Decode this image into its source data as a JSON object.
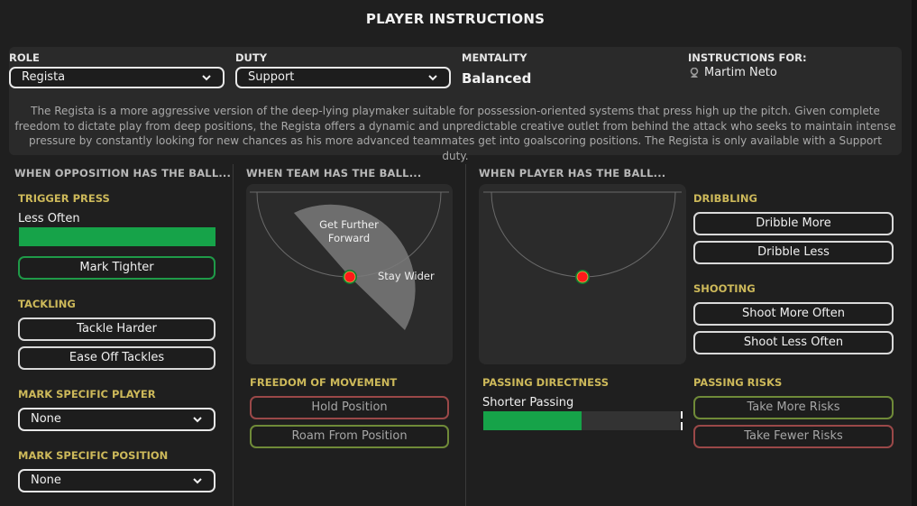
{
  "window": {
    "title": "PLAYER INSTRUCTIONS"
  },
  "header": {
    "role": {
      "label": "ROLE",
      "value": "Regista"
    },
    "duty": {
      "label": "DUTY",
      "value": "Support"
    },
    "mentality": {
      "label": "MENTALITY",
      "value": "Balanced"
    },
    "instructions_for": {
      "label": "INSTRUCTIONS FOR:",
      "player": "Martim Neto",
      "icon": "person-icon"
    },
    "description": "The Regista is a more aggressive version of the deep-lying playmaker suitable for possession-oriented systems that press high up the pitch. Given complete freedom to dictate play from deep positions, the Regista offers a dynamic and unpredictable creative outlet from behind the attack who seeks to maintain intense pressure by constantly looking for new chances as his more advanced teammates get into goalscoring positions. The Regista is only available with a Support duty."
  },
  "opposition": {
    "header": "WHEN OPPOSITION HAS THE BALL...",
    "trigger_press": {
      "label": "TRIGGER PRESS",
      "value": "Less Often",
      "fill_percent": 100
    },
    "mark_tighter": "Mark Tighter",
    "tackling": {
      "label": "TACKLING",
      "buttons": [
        "Tackle Harder",
        "Ease Off Tackles"
      ]
    },
    "mark_player": {
      "label": "MARK SPECIFIC PLAYER",
      "value": "None"
    },
    "mark_position": {
      "label": "MARK SPECIFIC POSITION",
      "value": "None"
    }
  },
  "team": {
    "header": "WHEN TEAM HAS THE BALL...",
    "pitch": {
      "zone_labels": [
        "Get Further Forward",
        "Stay Wider"
      ]
    },
    "freedom": {
      "label": "FREEDOM OF MOVEMENT",
      "buttons": [
        "Hold Position",
        "Roam From Position"
      ]
    }
  },
  "player": {
    "header": "WHEN PLAYER HAS THE BALL...",
    "dribbling": {
      "label": "DRIBBLING",
      "buttons": [
        "Dribble More",
        "Dribble Less"
      ]
    },
    "shooting": {
      "label": "SHOOTING",
      "buttons": [
        "Shoot More Often",
        "Shoot Less Often"
      ]
    },
    "passing_directness": {
      "label": "PASSING DIRECTNESS",
      "value": "Shorter Passing",
      "fill_percent": 50
    },
    "passing_risks": {
      "label": "PASSING RISKS",
      "buttons": [
        "Take More Risks",
        "Take Fewer Risks"
      ]
    }
  },
  "colors": {
    "accent_green": "#16a349",
    "section_gold": "#cdb95a",
    "player_dot": "#ff1a1a",
    "restricted_red": "#9a4848",
    "encouraged_olive": "#6f8a38"
  }
}
